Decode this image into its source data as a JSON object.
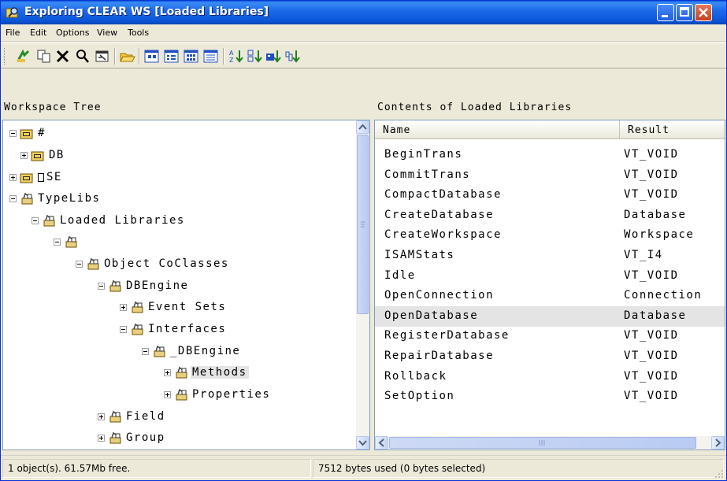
{
  "window": {
    "title": "Exploring CLEAR WS [Loaded Libraries]"
  },
  "menu": [
    "File",
    "Edit",
    "Options",
    "View",
    "Tools"
  ],
  "panes": {
    "left_title": "Workspace Tree",
    "right_title": "Contents of Loaded Libraries"
  },
  "tree": [
    {
      "label": "#",
      "expander": "minus",
      "icon": "folder-icon"
    },
    {
      "label": "DB",
      "expander": "plus",
      "icon": "folder-icon"
    },
    {
      "label": "SE",
      "prefix_box": true,
      "expander": "plus",
      "icon": "folder-icon"
    },
    {
      "label": "TypeLibs",
      "expander": "minus",
      "icon": "typelib-icon"
    },
    {
      "label": "Loaded Libraries",
      "expander": "minus",
      "icon": "typelib-icon"
    },
    {
      "label": "",
      "expander": "minus",
      "icon": "typelib-icon"
    },
    {
      "label": "Object CoClasses",
      "expander": "minus",
      "icon": "typelib-icon"
    },
    {
      "label": "DBEngine",
      "expander": "minus",
      "icon": "typelib-icon"
    },
    {
      "label": "Event Sets",
      "expander": "plus",
      "icon": "typelib-icon"
    },
    {
      "label": "Interfaces",
      "expander": "minus",
      "icon": "typelib-icon"
    },
    {
      "label": "_DBEngine",
      "expander": "minus",
      "icon": "typelib-icon"
    },
    {
      "label": "Methods",
      "expander": "plus",
      "icon": "typelib-icon",
      "selected": true
    },
    {
      "label": "Properties",
      "expander": "plus",
      "icon": "typelib-icon"
    },
    {
      "label": "Field",
      "expander": "plus",
      "icon": "typelib-icon"
    },
    {
      "label": "Group",
      "expander": "plus",
      "icon": "typelib-icon"
    }
  ],
  "list": {
    "columns": [
      "Name",
      "Result"
    ],
    "rows": [
      {
        "name": "BeginTrans",
        "result": "VT_VOID"
      },
      {
        "name": "CommitTrans",
        "result": "VT_VOID"
      },
      {
        "name": "CompactDatabase",
        "result": "VT_VOID"
      },
      {
        "name": "CreateDatabase",
        "result": "Database"
      },
      {
        "name": "CreateWorkspace",
        "result": "Workspace"
      },
      {
        "name": "ISAMStats",
        "result": "VT_I4"
      },
      {
        "name": "Idle",
        "result": "VT_VOID"
      },
      {
        "name": "OpenConnection",
        "result": "Connection"
      },
      {
        "name": "OpenDatabase",
        "result": "Database",
        "selected": true
      },
      {
        "name": "RegisterDatabase",
        "result": "VT_VOID"
      },
      {
        "name": "RepairDatabase",
        "result": "VT_VOID"
      },
      {
        "name": "Rollback",
        "result": "VT_VOID"
      },
      {
        "name": "SetOption",
        "result": "VT_VOID"
      }
    ]
  },
  "status": {
    "left": "1 object(s). 61.57Mb free.",
    "right": "7512 bytes used (0 bytes selected)"
  },
  "toolbar_icons": [
    "up-folder-icon",
    "copy-icon",
    "delete-icon",
    "find-icon",
    "properties-icon",
    "open-folder-icon",
    "large-icons-view-icon",
    "small-icons-view-icon",
    "list-view-icon",
    "details-view-icon",
    "sort-ascending-icon",
    "sort-descending-icon",
    "sort-by-type-icon",
    "sort-by-size-icon"
  ]
}
